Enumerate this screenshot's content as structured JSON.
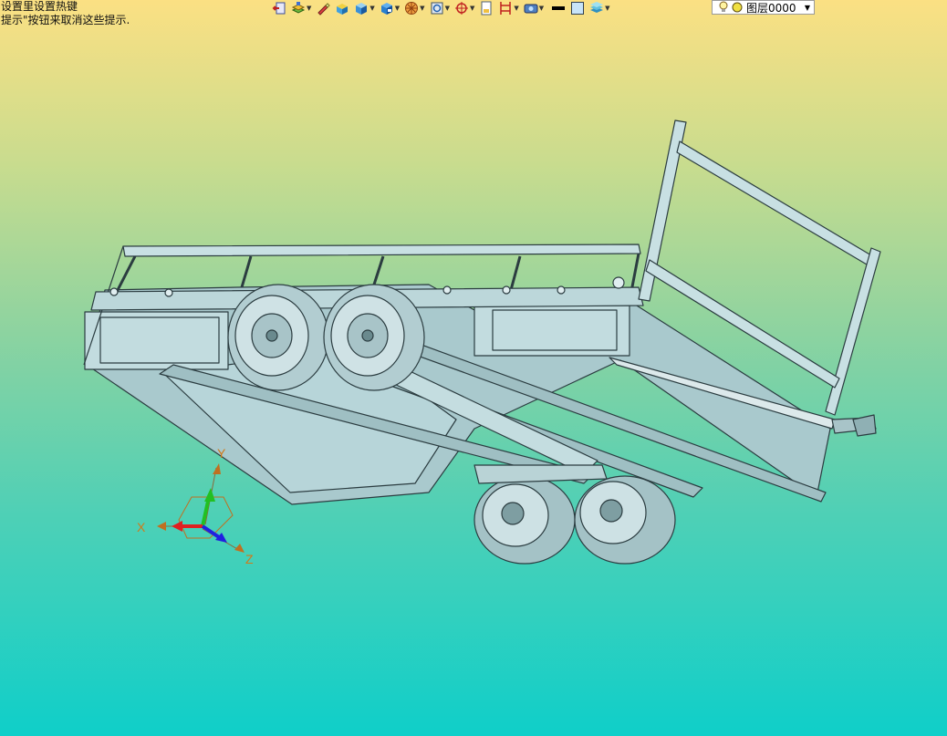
{
  "hints": {
    "line1": "设置里设置热键",
    "line2": "提示\"按钮来取消这些提示."
  },
  "toolbar": {
    "items": [
      {
        "name": "exit-icon"
      },
      {
        "name": "layers-stack-icon",
        "dropdown": true
      },
      {
        "name": "pen-icon"
      },
      {
        "name": "shade-box-icon"
      },
      {
        "name": "solid-box-icon",
        "dropdown": true
      },
      {
        "name": "view-cube-icon",
        "dropdown": true
      },
      {
        "name": "wheel-orange-icon",
        "dropdown": true
      },
      {
        "name": "zoom-fit-icon",
        "dropdown": true
      },
      {
        "name": "target-icon",
        "dropdown": true
      },
      {
        "name": "page-icon"
      },
      {
        "name": "frame-icon",
        "dropdown": true
      },
      {
        "name": "display-mode-icon",
        "dropdown": true
      },
      {
        "name": "line-color-black-icon"
      },
      {
        "name": "fill-color-icon"
      },
      {
        "name": "layer-manager-icon",
        "dropdown": true
      }
    ],
    "layer": {
      "label": "图层0000"
    }
  },
  "triad": {
    "x_label": "X",
    "y_label": "Y",
    "z_label": "Z"
  },
  "colors": {
    "accent_orange": "#d07a1a",
    "model_fill": "#b8d4d8",
    "model_line": "#2b3c40"
  }
}
